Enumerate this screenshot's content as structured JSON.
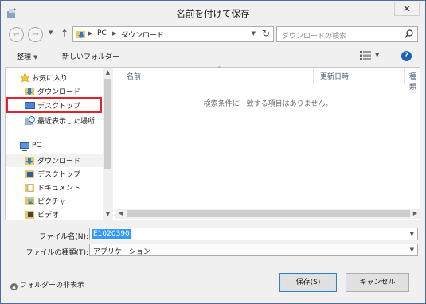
{
  "window": {
    "title": "名前を付けて保存",
    "close_label": "✕"
  },
  "navbar": {
    "back": "←",
    "forward": "→",
    "up": "↑",
    "breadcrumb": [
      "PC",
      "ダウンロード"
    ],
    "search_placeholder": "ダウンロードの検索"
  },
  "toolbar": {
    "organize_label": "整理",
    "new_folder_label": "新しいフォルダー",
    "help_label": "?"
  },
  "nav_pane": {
    "favorites": {
      "header": "お気に入り",
      "items": [
        "ダウンロード",
        "デスクトップ",
        "最近表示した場所"
      ]
    },
    "pc": {
      "header": "PC",
      "items": [
        "ダウンロード",
        "デスクトップ",
        "ドキュメント",
        "ピクチャ",
        "ビデオ"
      ]
    }
  },
  "list": {
    "columns": [
      "名前",
      "更新日時",
      "種類"
    ],
    "empty_message": "検索条件に一致する項目はありません。"
  },
  "form": {
    "filename_label": "ファイル名(N):",
    "filename_value": "E1020390",
    "filetype_label": "ファイルの種類(T):",
    "filetype_value": "アプリケーション"
  },
  "footer": {
    "hide_folders_label": "フォルダーの非表示",
    "save_label": "保存(S)",
    "cancel_label": "キャンセル"
  },
  "colors": {
    "highlight_border": "#e2222d",
    "selection": "#3399ff",
    "accent": "#1c5fb7"
  }
}
